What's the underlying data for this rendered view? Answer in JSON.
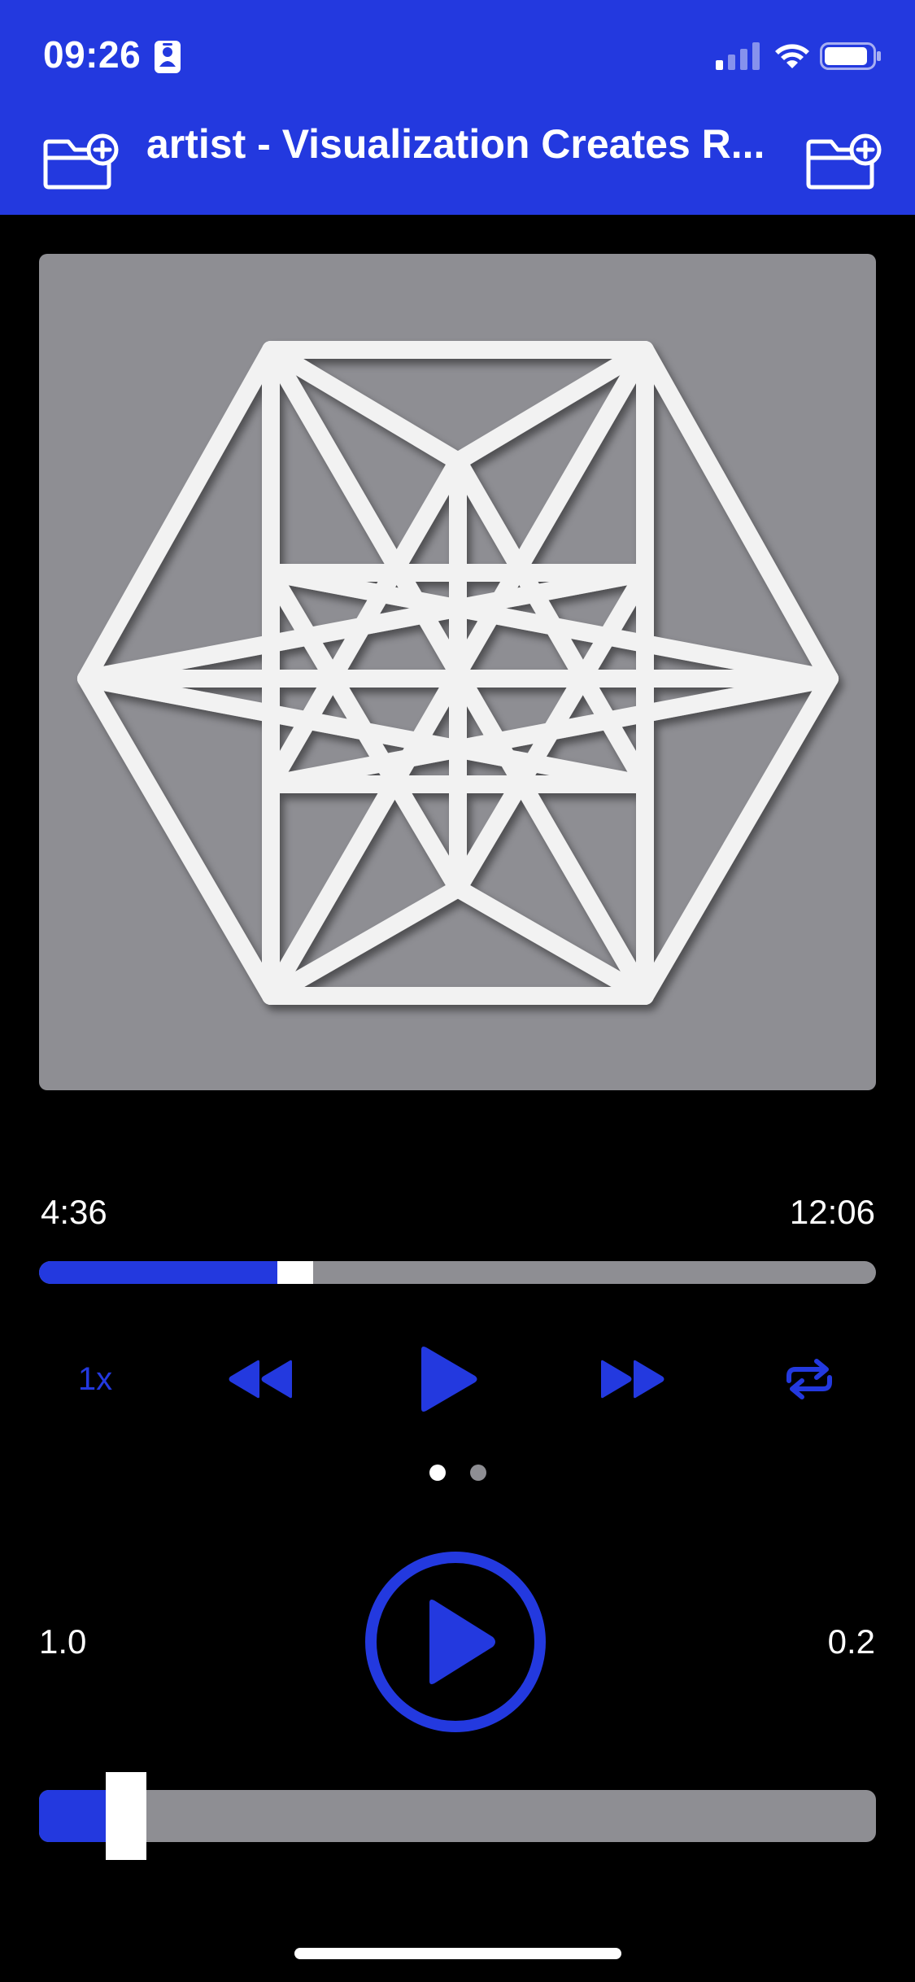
{
  "status_bar": {
    "time": "09:26"
  },
  "header": {
    "title": "artist - Visualization Creates R..."
  },
  "player": {
    "elapsed": "4:36",
    "total": "12:06",
    "progress": 0.285,
    "speed": "1x",
    "page_index": 1,
    "page_count": 2,
    "volume_left_label": "1.0",
    "volume_right_label": "0.2",
    "volume_level": 0.08
  },
  "colors": {
    "accent": "#2339DF",
    "track": "#8E8E93",
    "background": "#000000"
  },
  "icons": [
    "person-id-icon",
    "cellular-signal-icon",
    "wifi-icon",
    "battery-icon",
    "folder-add-icon",
    "rewind-icon",
    "play-icon",
    "fast-forward-icon",
    "repeat-icon",
    "play-circle-icon"
  ]
}
